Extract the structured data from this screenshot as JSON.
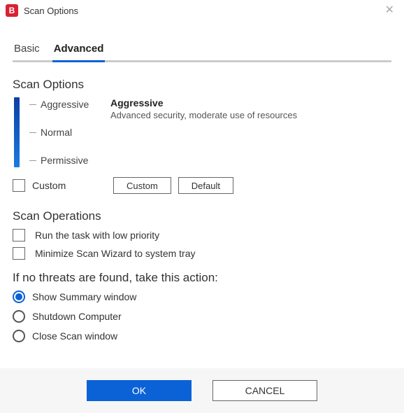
{
  "titlebar": {
    "icon_letter": "B",
    "title": "Scan Options"
  },
  "tabs": {
    "basic": "Basic",
    "advanced": "Advanced",
    "active": "advanced"
  },
  "scan_options": {
    "heading": "Scan Options",
    "levels": [
      "Aggressive",
      "Normal",
      "Permissive"
    ],
    "selected_title": "Aggressive",
    "selected_desc": "Advanced security, moderate use of resources",
    "custom_label": "Custom",
    "custom_checked": false,
    "custom_btn": "Custom",
    "default_btn": "Default"
  },
  "scan_operations": {
    "heading": "Scan Operations",
    "items": [
      {
        "label": "Run the task with low priority",
        "checked": false
      },
      {
        "label": "Minimize Scan Wizard to system tray",
        "checked": false
      }
    ]
  },
  "no_threats": {
    "heading": "If no threats are found, take this action:",
    "options": [
      {
        "label": "Show Summary window",
        "selected": true
      },
      {
        "label": "Shutdown Computer",
        "selected": false
      },
      {
        "label": "Close Scan window",
        "selected": false
      }
    ]
  },
  "footer": {
    "ok": "OK",
    "cancel": "CANCEL"
  }
}
